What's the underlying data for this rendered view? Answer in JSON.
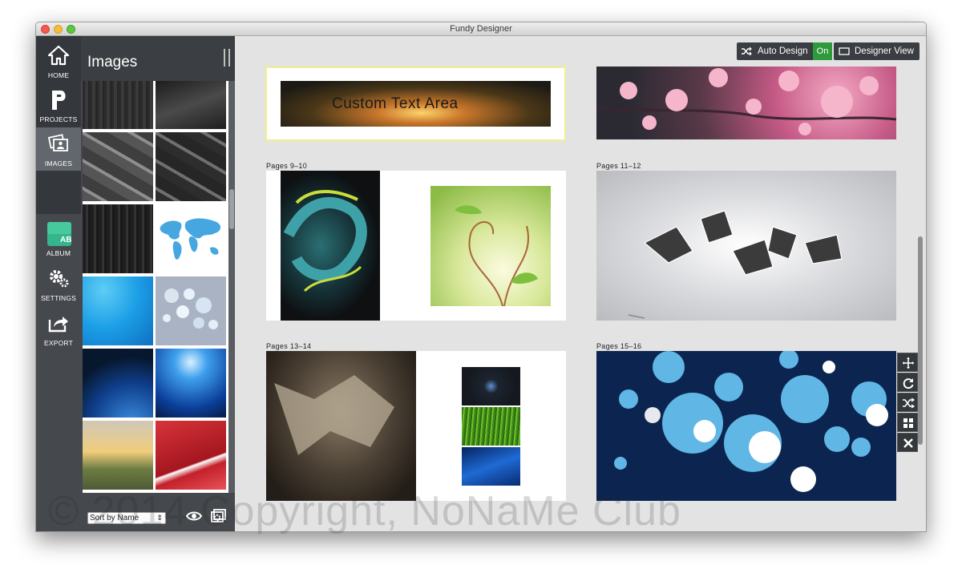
{
  "window": {
    "title": "Fundy Designer"
  },
  "nav": {
    "items": [
      {
        "label": "HOME",
        "icon": "home-icon"
      },
      {
        "label": "PROJECTS",
        "icon": "projects-icon"
      },
      {
        "label": "IMAGES",
        "icon": "images-icon"
      },
      {
        "label": "ALBUM",
        "icon": "album-icon",
        "badge": "AB"
      },
      {
        "label": "SETTINGS",
        "icon": "settings-icon"
      },
      {
        "label": "EXPORT",
        "icon": "export-icon"
      }
    ]
  },
  "images_panel": {
    "title": "Images",
    "sort_value": "Sort by Name",
    "sort_arrow": "⇕",
    "thumbnails": [
      "dark-wood-1",
      "dark-wood-2",
      "diagonal-wood-1",
      "diagonal-wood-2",
      "dark-wood-3",
      "world-map",
      "blue-waves",
      "bokeh-grey",
      "blue-earth",
      "blue-rays",
      "sunset-field",
      "red-waves"
    ]
  },
  "toolbar": {
    "auto_design_label": "Auto Design",
    "auto_design_state": "On",
    "designer_view_label": "Designer View"
  },
  "spreads": [
    {
      "label": "",
      "text_area": "Custom Text Area"
    },
    {
      "label": "Pages 9–10"
    },
    {
      "label": "Pages 11–12"
    },
    {
      "label": "Pages 13–14"
    },
    {
      "label": "Pages 15–16"
    }
  ],
  "side_tools": [
    "move-icon",
    "rotate-icon",
    "shuffle-icon",
    "grid-icon",
    "close-icon"
  ],
  "watermark": "© 2014 Copyright, NoNaMe Club",
  "colors": {
    "active_green": "#2e9a3b",
    "nav_bg": "#45484c",
    "selection_yellow": "#f3ee8a"
  }
}
